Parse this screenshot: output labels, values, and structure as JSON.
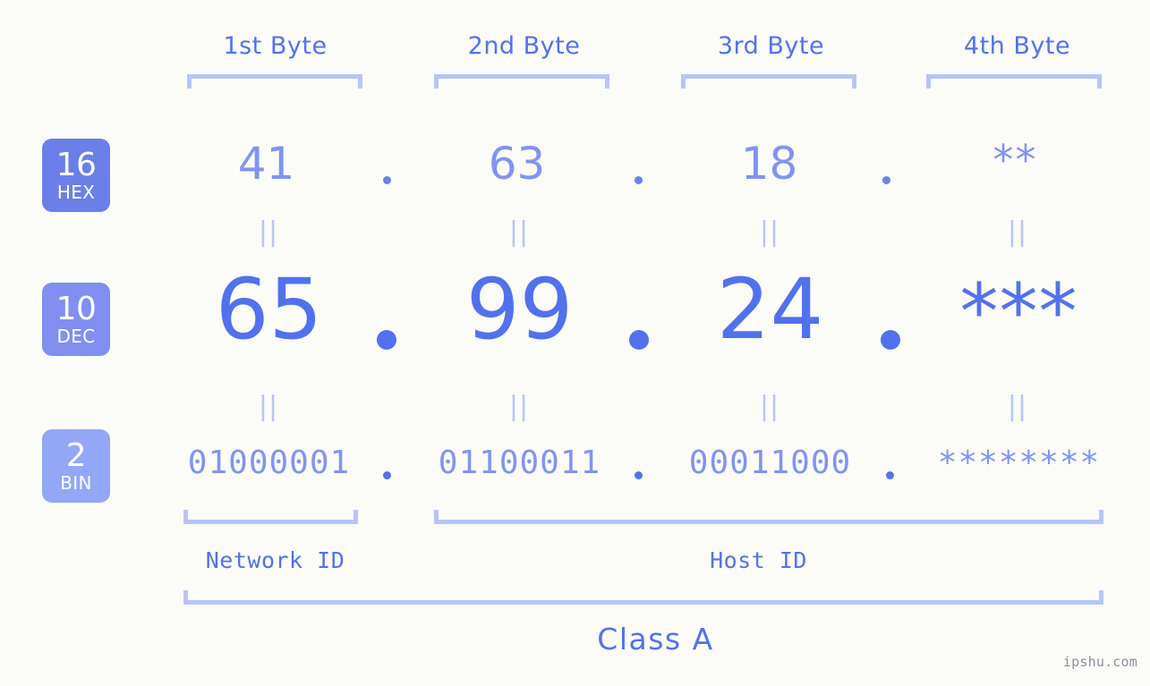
{
  "meta": {
    "watermark": "ipshu.com",
    "background": "#fbfcf8",
    "accent": "#5271ed",
    "accent_light": "#8094f0",
    "accent_pale": "#b9c4f7"
  },
  "byte_headers": [
    {
      "label": "1st Byte"
    },
    {
      "label": "2nd Byte"
    },
    {
      "label": "3rd Byte"
    },
    {
      "label": "4th Byte"
    }
  ],
  "bases": [
    {
      "number": "16",
      "name": "HEX",
      "color": "#6b7fe8"
    },
    {
      "number": "10",
      "name": "DEC",
      "color": "#808ff0"
    },
    {
      "number": "2",
      "name": "BIN",
      "color": "#93a7f7"
    }
  ],
  "rows": {
    "hex": {
      "base_number": "16",
      "base_name": "HEX",
      "octets": [
        "41",
        "63",
        "18",
        "**"
      ],
      "separator": "."
    },
    "dec": {
      "base_number": "10",
      "base_name": "DEC",
      "octets": [
        "65",
        "99",
        "24",
        "***"
      ],
      "separator": "."
    },
    "bin": {
      "base_number": "2",
      "base_name": "BIN",
      "octets": [
        "01000001",
        "01100011",
        "00011000",
        "********"
      ],
      "separator": "."
    }
  },
  "equality_symbol": "||",
  "segments": {
    "network_id": "Network ID",
    "host_id": "Host ID",
    "class": "Class A"
  }
}
